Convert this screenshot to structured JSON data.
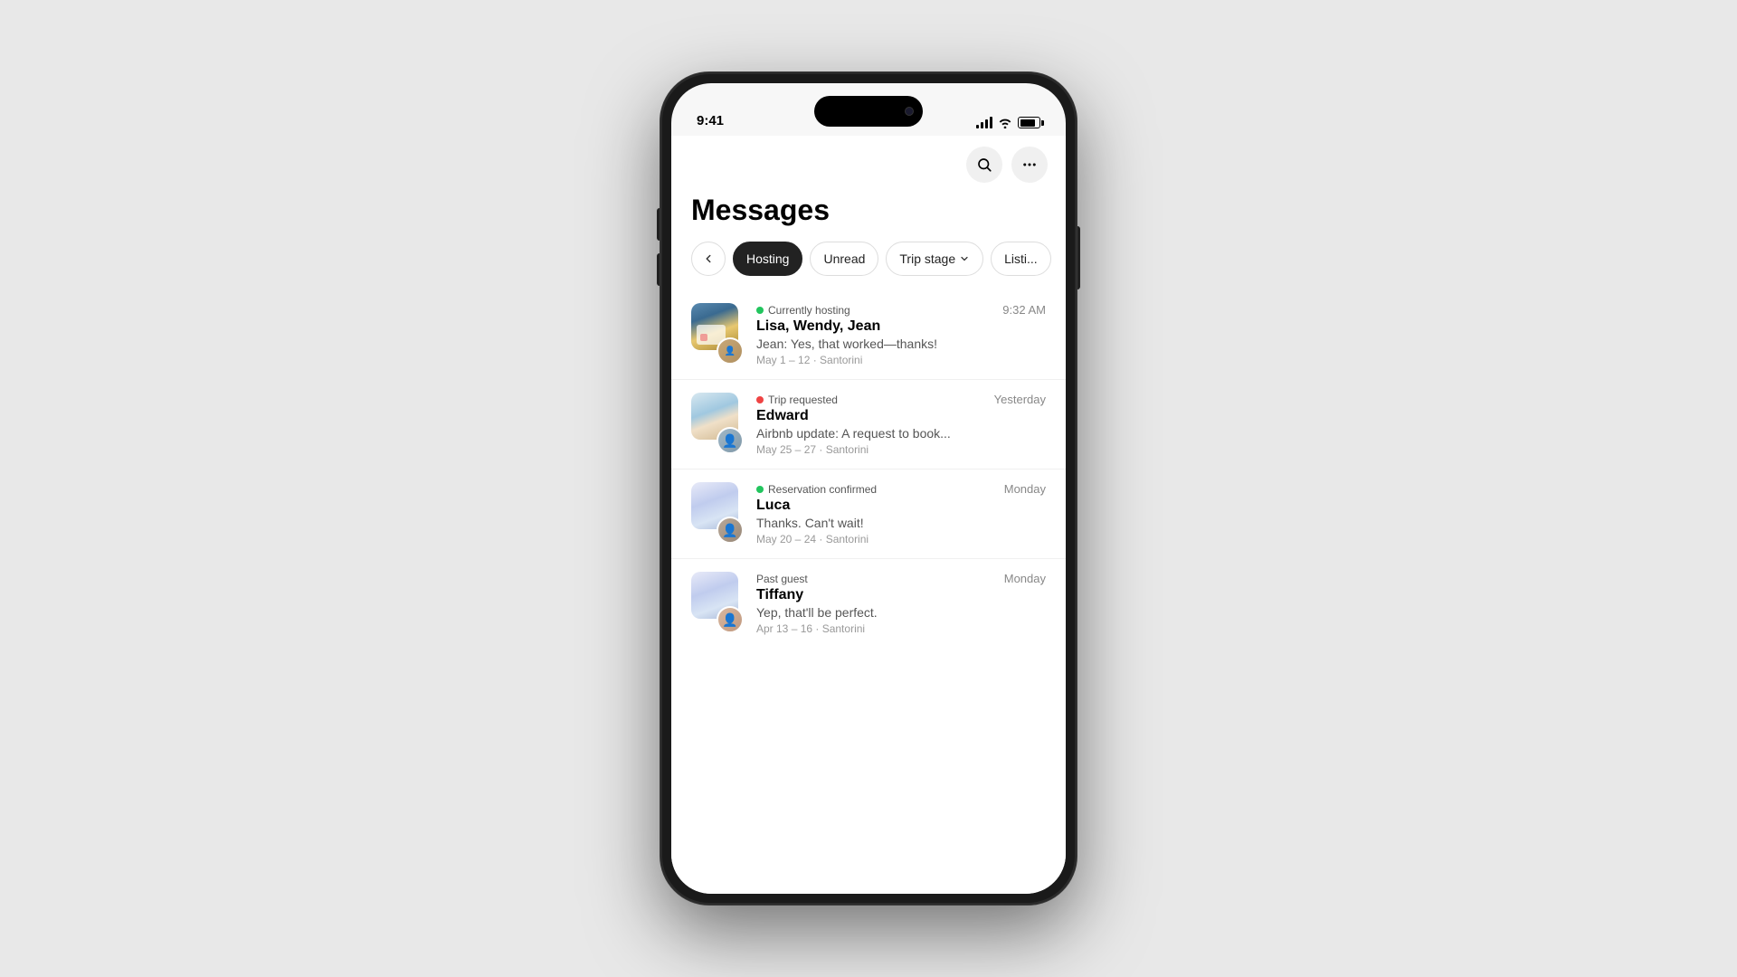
{
  "status_bar": {
    "time": "9:41",
    "signal": "●●●●",
    "wifi": "wifi",
    "battery": "battery"
  },
  "header": {
    "search_label": "search",
    "more_label": "more"
  },
  "page": {
    "title": "Messages"
  },
  "filters": {
    "back_label": "←",
    "items": [
      {
        "id": "hosting",
        "label": "Hosting",
        "active": true
      },
      {
        "id": "unread",
        "label": "Unread",
        "active": false
      },
      {
        "id": "trip-stage",
        "label": "Trip stage",
        "has_dropdown": true,
        "active": false
      },
      {
        "id": "listing",
        "label": "Listi...",
        "active": false
      }
    ]
  },
  "messages": [
    {
      "id": 1,
      "status_dot": "green",
      "status_text": "Currently hosting",
      "time": "9:32 AM",
      "names": "Lisa, Wendy, Jean",
      "preview": "Jean: Yes, that worked—thanks!",
      "dates": "May 1 – 12 · Santorini",
      "has_secondary_avatar": true,
      "avatar_bg": "house-img-1",
      "person_bg": "person-1"
    },
    {
      "id": 2,
      "status_dot": "red",
      "status_text": "Trip requested",
      "time": "Yesterday",
      "names": "Edward",
      "preview": "Airbnb update: A request to book...",
      "dates": "May 25 – 27 · Santorini",
      "has_secondary_avatar": true,
      "avatar_bg": "house-img-2",
      "person_bg": "person-2"
    },
    {
      "id": 3,
      "status_dot": "green",
      "status_text": "Reservation confirmed",
      "time": "Monday",
      "names": "Luca",
      "preview": "Thanks. Can't wait!",
      "dates": "May 20 – 24 · Santorini",
      "has_secondary_avatar": true,
      "avatar_bg": "house-img-3",
      "person_bg": "person-3"
    },
    {
      "id": 4,
      "status_dot": null,
      "status_text": "Past guest",
      "time": "Monday",
      "names": "Tiffany",
      "preview": "Yep, that'll be perfect.",
      "dates": "Apr 13 – 16 · Santorini",
      "has_secondary_avatar": true,
      "avatar_bg": "house-img-3",
      "person_bg": "person-4"
    }
  ]
}
